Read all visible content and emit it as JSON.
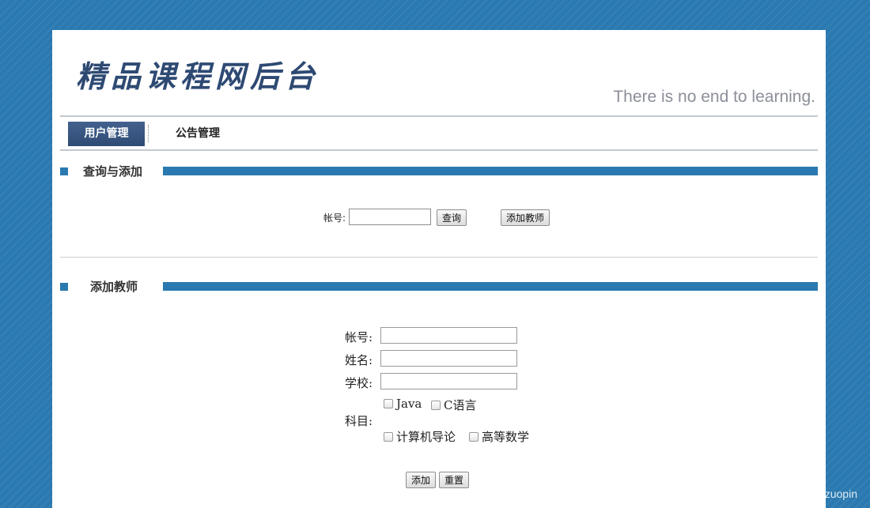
{
  "header": {
    "logo_text": "精品课程网后台",
    "slogan": "There is no end to learning."
  },
  "nav": {
    "tabs": [
      {
        "label": "用户管理",
        "active": true
      },
      {
        "label": "公告管理",
        "active": false
      }
    ]
  },
  "search_section": {
    "title": "查询与添加",
    "account_label": "帐号:",
    "account_value": "",
    "query_button": "查询",
    "add_teacher_button": "添加教师"
  },
  "add_section": {
    "title": "添加教师",
    "fields": {
      "account_label": "帐号:",
      "name_label": "姓名:",
      "school_label": "学校:",
      "subject_label": "科目:"
    },
    "subjects": [
      "Java",
      "C语言",
      "计算机导论",
      "高等数学"
    ],
    "submit_button": "添加",
    "reset_button": "重置"
  },
  "watermark": "CSDN @biyezuopin",
  "colors": {
    "background": "#2a79b0",
    "nav_active": "#2f4b75",
    "section_bar": "#2a79b0",
    "slogan": "#8b8f98"
  }
}
